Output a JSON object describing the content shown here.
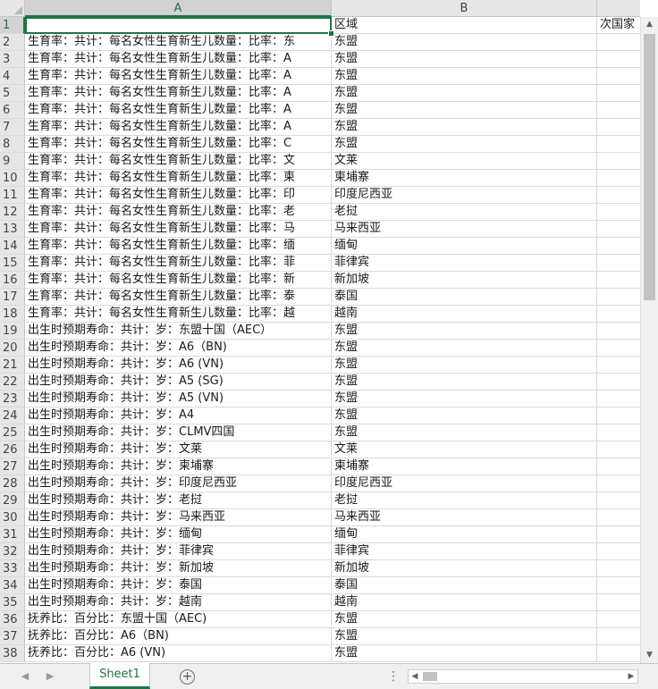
{
  "columns": [
    "A",
    "B"
  ],
  "selected_cell": "A1",
  "rows": [
    {
      "n": "1",
      "a": "",
      "b": "区域",
      "c": "次国家"
    },
    {
      "n": "2",
      "a": "生育率：共计：每名女性生育新生儿数量：比率：东",
      "b": "东盟",
      "c": ""
    },
    {
      "n": "3",
      "a": "生育率：共计：每名女性生育新生儿数量：比率：A",
      "b": "东盟",
      "c": ""
    },
    {
      "n": "4",
      "a": "生育率：共计：每名女性生育新生儿数量：比率：A",
      "b": "东盟",
      "c": ""
    },
    {
      "n": "5",
      "a": "生育率：共计：每名女性生育新生儿数量：比率：A",
      "b": "东盟",
      "c": ""
    },
    {
      "n": "6",
      "a": "生育率：共计：每名女性生育新生儿数量：比率：A",
      "b": "东盟",
      "c": ""
    },
    {
      "n": "7",
      "a": "生育率：共计：每名女性生育新生儿数量：比率：A",
      "b": "东盟",
      "c": ""
    },
    {
      "n": "8",
      "a": "生育率：共计：每名女性生育新生儿数量：比率：C",
      "b": "东盟",
      "c": ""
    },
    {
      "n": "9",
      "a": "生育率：共计：每名女性生育新生儿数量：比率：文",
      "b": "文莱",
      "c": ""
    },
    {
      "n": "10",
      "a": "生育率：共计：每名女性生育新生儿数量：比率：柬",
      "b": "柬埔寨",
      "c": ""
    },
    {
      "n": "11",
      "a": "生育率：共计：每名女性生育新生儿数量：比率：印",
      "b": "印度尼西亚",
      "c": ""
    },
    {
      "n": "12",
      "a": "生育率：共计：每名女性生育新生儿数量：比率：老",
      "b": "老挝",
      "c": ""
    },
    {
      "n": "13",
      "a": "生育率：共计：每名女性生育新生儿数量：比率：马",
      "b": "马来西亚",
      "c": ""
    },
    {
      "n": "14",
      "a": "生育率：共计：每名女性生育新生儿数量：比率：缅",
      "b": "缅甸",
      "c": ""
    },
    {
      "n": "15",
      "a": "生育率：共计：每名女性生育新生儿数量：比率：菲",
      "b": "菲律宾",
      "c": ""
    },
    {
      "n": "16",
      "a": "生育率：共计：每名女性生育新生儿数量：比率：新",
      "b": "新加坡",
      "c": ""
    },
    {
      "n": "17",
      "a": "生育率：共计：每名女性生育新生儿数量：比率：泰",
      "b": "泰国",
      "c": ""
    },
    {
      "n": "18",
      "a": "生育率：共计：每名女性生育新生儿数量：比率：越",
      "b": "越南",
      "c": ""
    },
    {
      "n": "19",
      "a": "出生时预期寿命：共计：岁：东盟十国（AEC）",
      "b": "东盟",
      "c": ""
    },
    {
      "n": "20",
      "a": "出生时预期寿命：共计：岁：A6（BN)",
      "b": "东盟",
      "c": ""
    },
    {
      "n": "21",
      "a": "出生时预期寿命：共计：岁：A6 (VN)",
      "b": "东盟",
      "c": ""
    },
    {
      "n": "22",
      "a": "出生时预期寿命：共计：岁：A5 (SG)",
      "b": "东盟",
      "c": ""
    },
    {
      "n": "23",
      "a": "出生时预期寿命：共计：岁：A5 (VN)",
      "b": "东盟",
      "c": ""
    },
    {
      "n": "24",
      "a": "出生时预期寿命：共计：岁：A4",
      "b": "东盟",
      "c": ""
    },
    {
      "n": "25",
      "a": "出生时预期寿命：共计：岁：CLMV四国",
      "b": "东盟",
      "c": ""
    },
    {
      "n": "26",
      "a": "出生时预期寿命：共计：岁：文莱",
      "b": "文莱",
      "c": ""
    },
    {
      "n": "27",
      "a": "出生时预期寿命：共计：岁：柬埔寨",
      "b": "柬埔寨",
      "c": ""
    },
    {
      "n": "28",
      "a": "出生时预期寿命：共计：岁：印度尼西亚",
      "b": "印度尼西亚",
      "c": ""
    },
    {
      "n": "29",
      "a": "出生时预期寿命：共计：岁：老挝",
      "b": "老挝",
      "c": ""
    },
    {
      "n": "30",
      "a": "出生时预期寿命：共计：岁：马来西亚",
      "b": "马来西亚",
      "c": ""
    },
    {
      "n": "31",
      "a": "出生时预期寿命：共计：岁：缅甸",
      "b": "缅甸",
      "c": ""
    },
    {
      "n": "32",
      "a": "出生时预期寿命：共计：岁：菲律宾",
      "b": "菲律宾",
      "c": ""
    },
    {
      "n": "33",
      "a": "出生时预期寿命：共计：岁：新加坡",
      "b": "新加坡",
      "c": ""
    },
    {
      "n": "34",
      "a": "出生时预期寿命：共计：岁：泰国",
      "b": "泰国",
      "c": ""
    },
    {
      "n": "35",
      "a": "出生时预期寿命：共计：岁：越南",
      "b": "越南",
      "c": ""
    },
    {
      "n": "36",
      "a": "抚养比：百分比：东盟十国（AEC)",
      "b": "东盟",
      "c": ""
    },
    {
      "n": "37",
      "a": "抚养比：百分比：A6（BN)",
      "b": "东盟",
      "c": ""
    },
    {
      "n": "38",
      "a": "抚养比：百分比：A6 (VN)",
      "b": "东盟",
      "c": ""
    }
  ],
  "sheet_tabs": [
    "Sheet1"
  ],
  "icons": {
    "add_sheet": "plus-circle-icon",
    "nav_prev": "triangle-left-icon",
    "nav_next": "triangle-right-icon",
    "scroll_up": "triangle-up-icon",
    "scroll_down": "triangle-down-icon",
    "scroll_left": "triangle-left-icon",
    "scroll_right": "triangle-right-icon"
  },
  "colors": {
    "accent": "#217346",
    "header_bg": "#e6e6e6",
    "gridline": "#dadada"
  }
}
